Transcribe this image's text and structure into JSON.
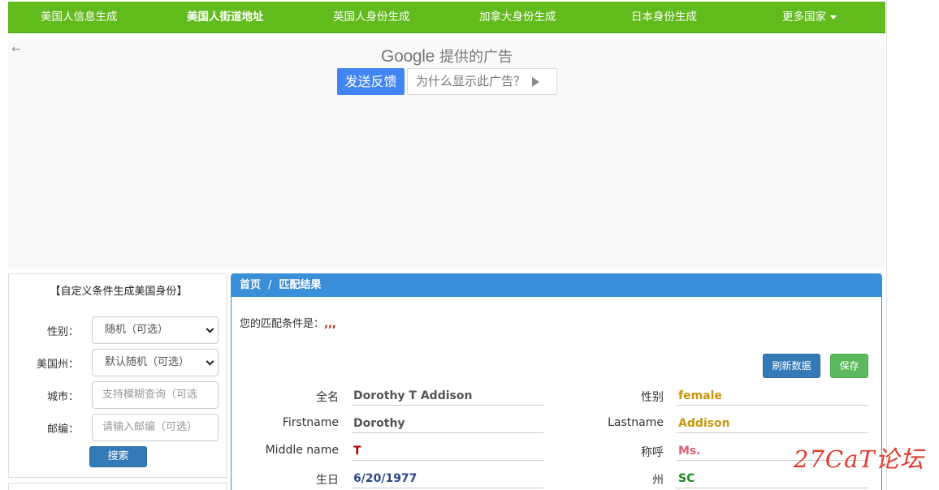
{
  "nav": {
    "items": [
      "美国人信息生成",
      "美国人街道地址",
      "英国人身份生成",
      "加拿大身份生成",
      "日本身份生成",
      "更多国家"
    ]
  },
  "ad": {
    "back_glyph": "←",
    "google_word": "Google",
    "provided_text": "提供的广告",
    "feedback_label": "发送反馈",
    "why_label": "为什么显示此广告？"
  },
  "sidebar": {
    "title": "【自定义条件生成美国身份】",
    "fields": [
      {
        "label": "性别：",
        "value": "随机（可选）"
      },
      {
        "label": "美国州：",
        "value": "默认随机（可选）"
      },
      {
        "label": "城市：",
        "placeholder": "支持模糊查询（可选"
      },
      {
        "label": "邮编：",
        "placeholder": "请输入邮编（可选）"
      }
    ],
    "search_label": "搜索"
  },
  "panel": {
    "breadcrumb_home": "首页",
    "breadcrumb_sep": "/",
    "breadcrumb_current": "匹配结果",
    "condition_label": "您的匹配条件是：",
    "condition_value": ",,,",
    "refresh_label": "刷新数据",
    "save_label": "保存",
    "fields": {
      "fullname": {
        "label": "全名",
        "value": "Dorothy T Addison"
      },
      "gender": {
        "label": "性别",
        "value": "female"
      },
      "firstname": {
        "label": "Firstname",
        "value": "Dorothy"
      },
      "lastname": {
        "label": "Lastname",
        "value": "Addison"
      },
      "middlename": {
        "label": "Middle name",
        "value": "T"
      },
      "title": {
        "label": "称呼",
        "value": "Ms."
      },
      "birthday": {
        "label": "生日",
        "value": "6/20/1977"
      },
      "state": {
        "label": "州",
        "value": "SC"
      }
    }
  },
  "watermark": "27CaT论坛",
  "colors": {
    "nav_bg": "#62bb1d",
    "panel_header": "#3a8fd9",
    "primary_button": "#337ab7",
    "save_button": "#5cb85c",
    "google_feedback": "#4285f4"
  }
}
